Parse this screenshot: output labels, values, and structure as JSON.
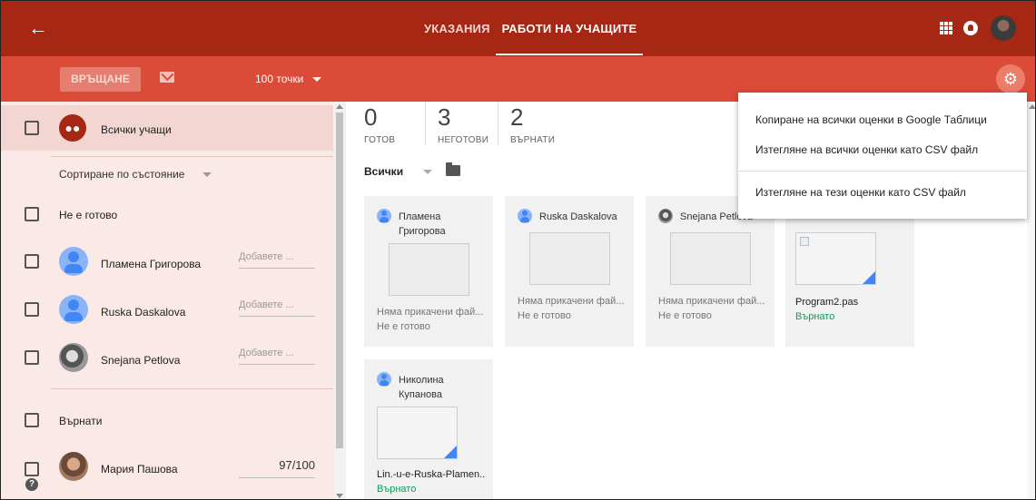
{
  "header": {
    "back_icon": "arrow-left-icon",
    "tabs": [
      {
        "label": "УКАЗАНИЯ",
        "active": false
      },
      {
        "label": "РАБОТИ НА УЧАЩИТЕ",
        "active": true
      }
    ],
    "apps_icon": "apps-grid-icon",
    "notifications_icon": "notifications-icon"
  },
  "toolbar": {
    "return_label": "ВРЪЩАНЕ",
    "email_icon": "email-icon",
    "points_label": "100 точки",
    "settings_icon": "gear-icon"
  },
  "sidebar": {
    "all_students_label": "Всички учащи",
    "sort_label": "Сортиране по състояние",
    "group_not_done": "Не е готово",
    "group_returned": "Върнати",
    "grade_placeholder": "Добавете ...",
    "students_not_done": [
      {
        "name": "Пламена Григорова"
      },
      {
        "name": "Ruska Daskalova"
      },
      {
        "name": "Snejana Petlova"
      }
    ],
    "students_returned": [
      {
        "name": "Мария Пашова",
        "grade": "97/100"
      }
    ]
  },
  "stats": [
    {
      "value": "0",
      "label": "ГОТОВ"
    },
    {
      "value": "3",
      "label": "НЕГОТОВИ"
    },
    {
      "value": "2",
      "label": "ВЪРНАТИ"
    }
  ],
  "filter_label": "Всички",
  "cards": [
    {
      "name": "Пламена Григорова",
      "file": "Няма прикачени фай...",
      "status": "Не е готово"
    },
    {
      "name": "Ruska Daskalova",
      "file": "Няма прикачени фай...",
      "status": "Не е готово"
    },
    {
      "name": "Snejana Petlova",
      "file": "Няма прикачени фай...",
      "status": "Не е готово"
    },
    {
      "name": "",
      "file": "Program2.pas",
      "status": "Върнато"
    },
    {
      "name": "Николина Купанова",
      "file": "Lin.-u-e-Ruska-Plamen...",
      "status": "Върнато"
    }
  ],
  "menu": {
    "items": [
      "Копиране на всички оценки в Google Таблици",
      "Изтегляне на всички оценки като CSV файл",
      "Изтегляне на тези оценки като CSV файл"
    ]
  },
  "colors": {
    "header_bg": "#a52714",
    "toolbar_bg": "#dc4a38",
    "sidebar_bg": "#fbe9e7",
    "returned_status": "#0f9d58"
  }
}
